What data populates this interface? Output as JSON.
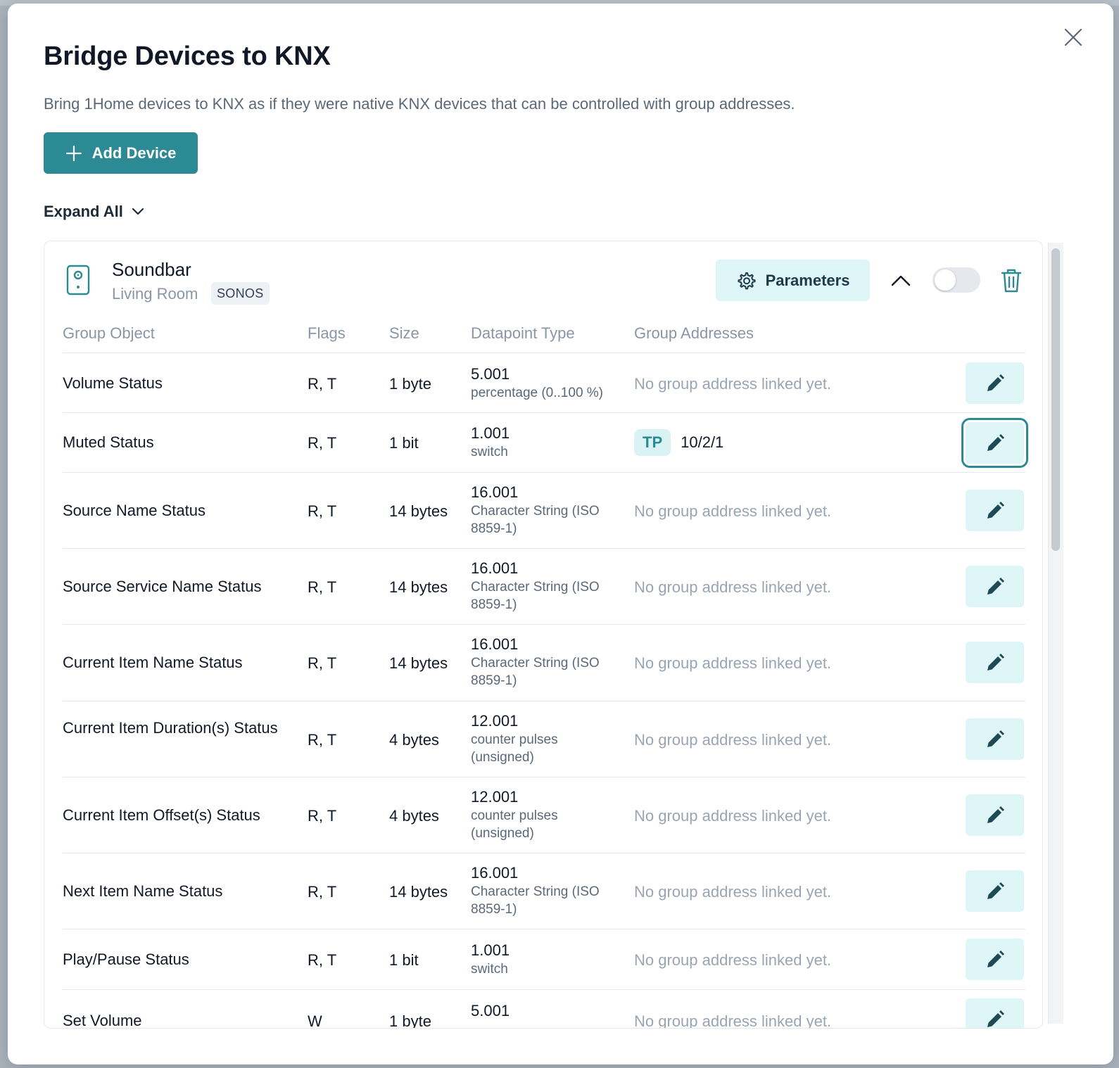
{
  "modal": {
    "title": "Bridge Devices to KNX",
    "subtitle": "Bring 1Home devices to KNX as if they were native KNX devices that can be controlled with group addresses.",
    "add_device_label": "Add Device",
    "expand_all_label": "Expand All"
  },
  "device": {
    "name": "Soundbar",
    "room": "Living Room",
    "brand": "SONOS",
    "parameters_label": "Parameters",
    "enabled": false
  },
  "columns": {
    "group_object": "Group Object",
    "flags": "Flags",
    "size": "Size",
    "datapoint_type": "Datapoint Type",
    "group_addresses": "Group Addresses"
  },
  "rows": [
    {
      "object": "Volume Status",
      "flags": "R, T",
      "size": "1 byte",
      "dpt": "5.001",
      "dpt_desc": "percentage (0..100 %)",
      "ga": "No group address linked yet."
    },
    {
      "object": "Muted Status",
      "flags": "R, T",
      "size": "1 bit",
      "dpt": "1.001",
      "dpt_desc": "switch",
      "ga_type": "TP",
      "ga_value": "10/2/1"
    },
    {
      "object": "Source Name Status",
      "flags": "R, T",
      "size": "14 bytes",
      "dpt": "16.001",
      "dpt_desc": "Character String (ISO 8859-1)",
      "ga": "No group address linked yet."
    },
    {
      "object": "Source Service Name Status",
      "flags": "R, T",
      "size": "14 bytes",
      "dpt": "16.001",
      "dpt_desc": "Character String (ISO 8859-1)",
      "ga": "No group address linked yet."
    },
    {
      "object": "Current Item Name Status",
      "flags": "R, T",
      "size": "14 bytes",
      "dpt": "16.001",
      "dpt_desc": "Character String (ISO 8859-1)",
      "ga": "No group address linked yet."
    },
    {
      "object": "Current Item Duration(s) Status",
      "flags": "R, T",
      "size": "4 bytes",
      "dpt": "12.001",
      "dpt_desc": "counter pulses (unsigned)",
      "ga": "No group address linked yet."
    },
    {
      "object": "Current Item Offset(s) Status",
      "flags": "R, T",
      "size": "4 bytes",
      "dpt": "12.001",
      "dpt_desc": "counter pulses (unsigned)",
      "ga": "No group address linked yet."
    },
    {
      "object": "Next Item Name Status",
      "flags": "R, T",
      "size": "14 bytes",
      "dpt": "16.001",
      "dpt_desc": "Character String (ISO 8859-1)",
      "ga": "No group address linked yet."
    },
    {
      "object": "Play/Pause Status",
      "flags": "R, T",
      "size": "1 bit",
      "dpt": "1.001",
      "dpt_desc": "switch",
      "ga": "No group address linked yet."
    },
    {
      "object": "Set Volume",
      "flags": "W",
      "size": "1 byte",
      "dpt": "5.001",
      "dpt_desc": "",
      "ga": "No group address linked yet."
    }
  ],
  "colors": {
    "primary": "#2b8a93",
    "primary_light": "#def6f8",
    "muted_text": "#8a96a6"
  }
}
